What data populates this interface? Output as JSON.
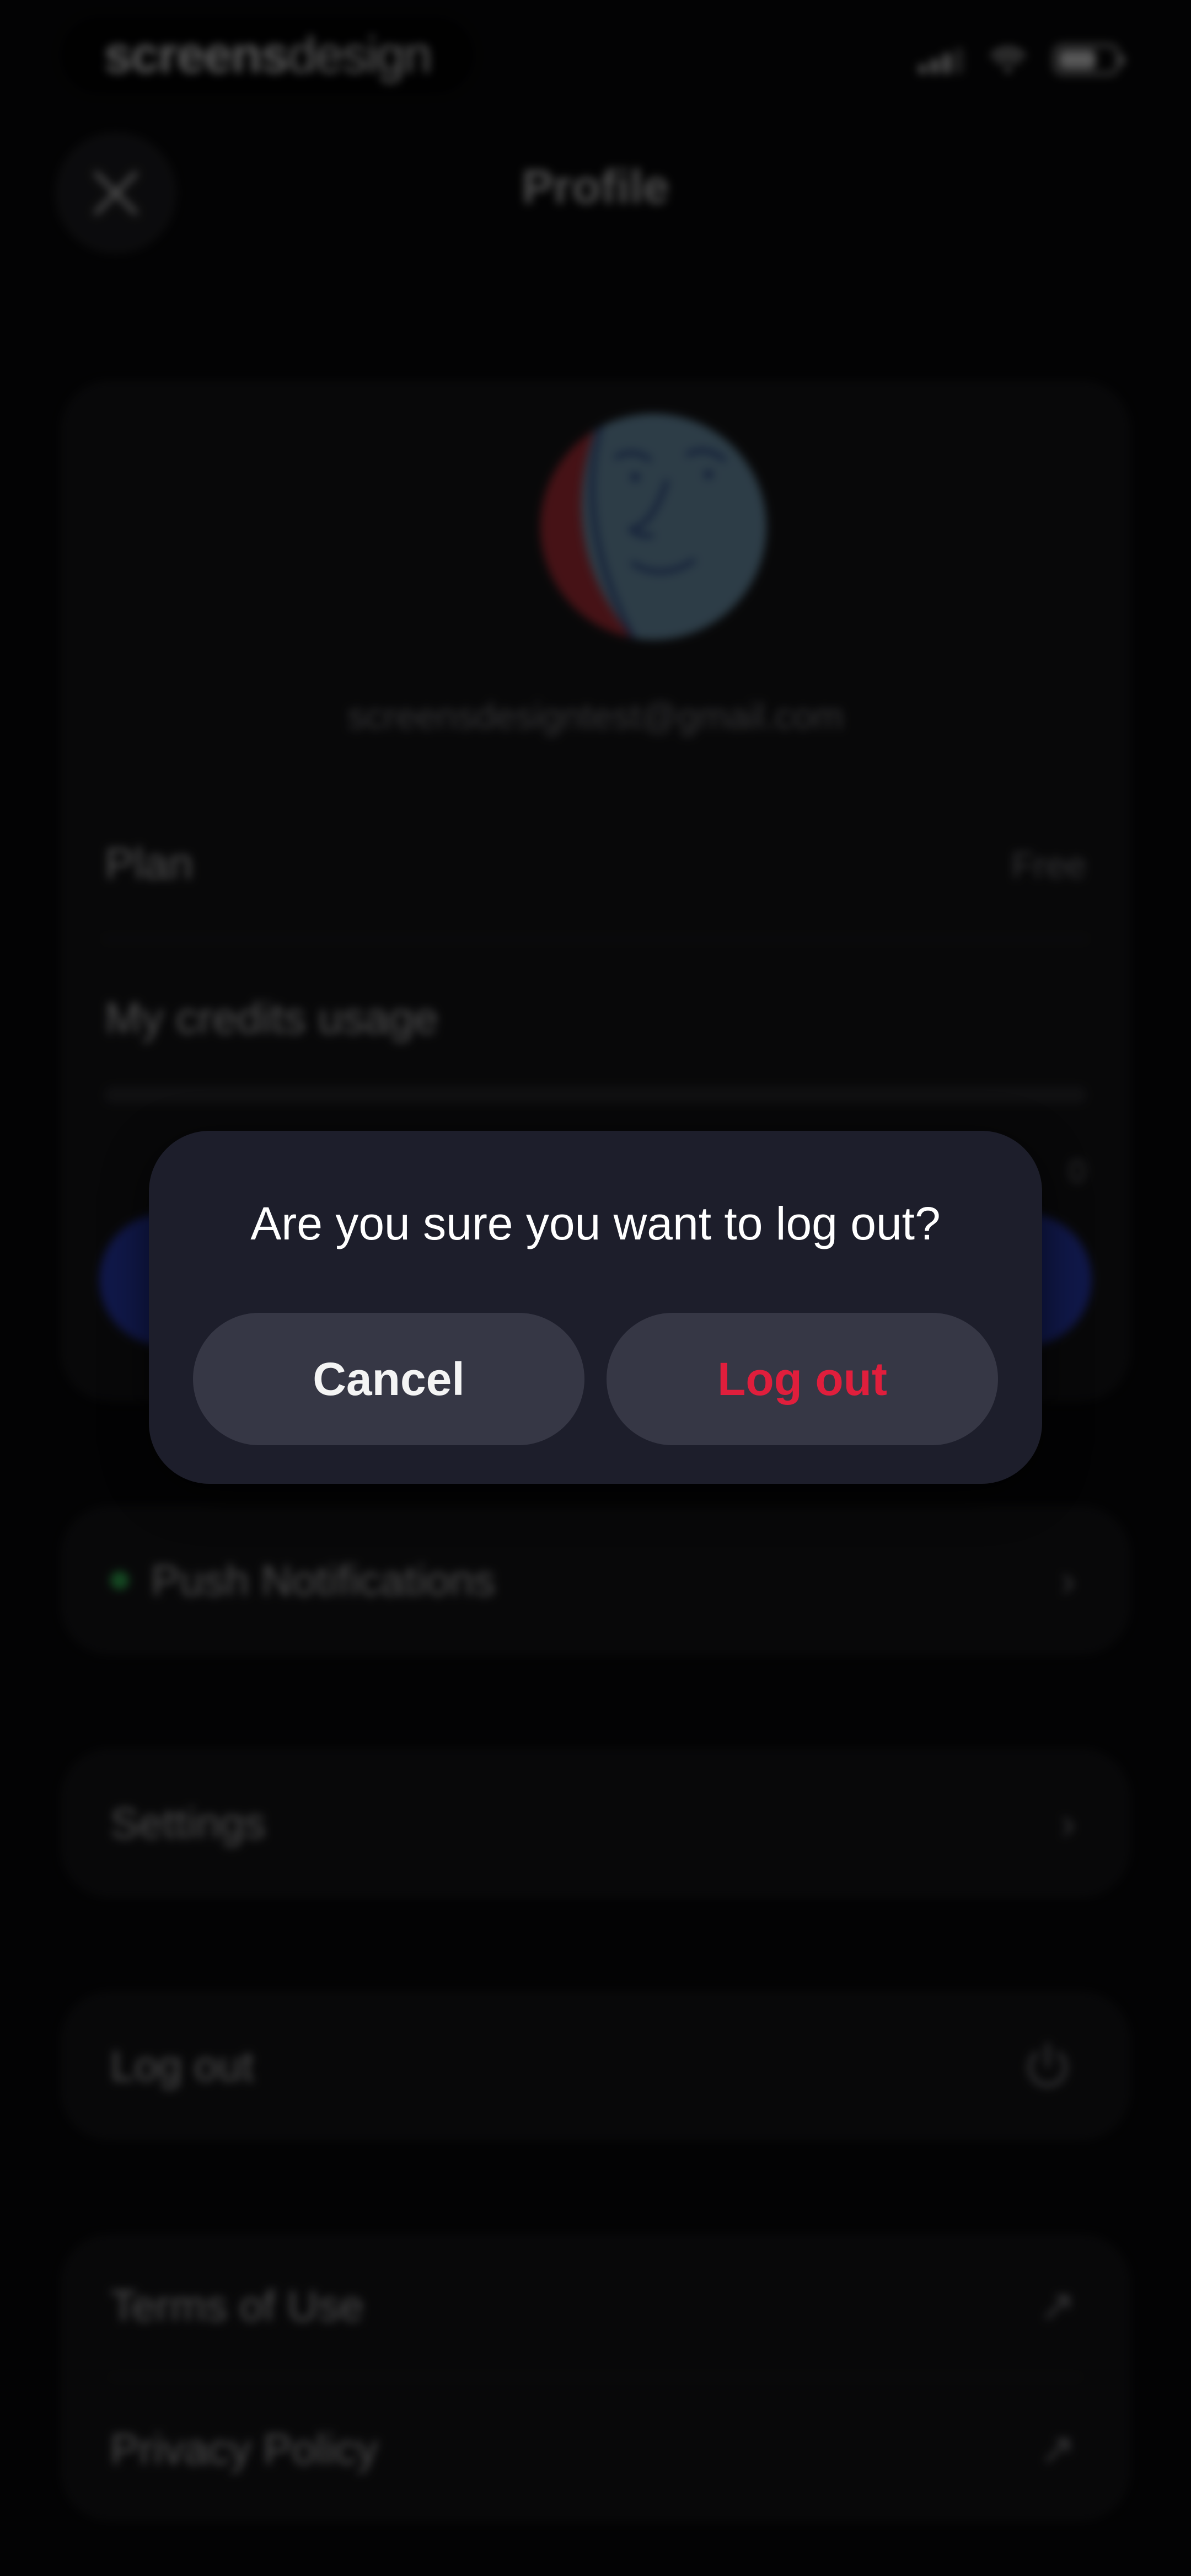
{
  "status_bar": {
    "brand_bold": "screens",
    "brand_light": "design"
  },
  "header": {
    "title": "Profile",
    "close_icon": "close-icon"
  },
  "profile": {
    "email": "screensdesigntest@gmail.com",
    "plan_label": "Plan",
    "plan_value": "Free",
    "credits_label": "My credits usage",
    "usage_value": "0"
  },
  "menu": {
    "push_notifications": "Push Notifications",
    "settings": "Settings",
    "logout": "Log out",
    "terms": "Terms of Use",
    "privacy": "Privacy Policy"
  },
  "dialog": {
    "message": "Are you sure you want to log out?",
    "cancel": "Cancel",
    "confirm": "Log out"
  },
  "colors": {
    "accent_blue": "#2c40c8",
    "destructive_red": "#e01e3c",
    "status_green": "#36c45a"
  }
}
